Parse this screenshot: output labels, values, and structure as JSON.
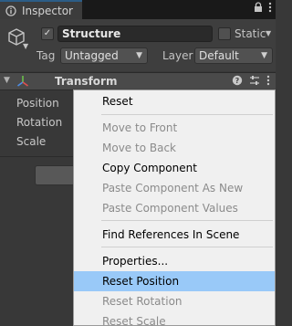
{
  "tab": {
    "title": "Inspector",
    "icon": "info-icon"
  },
  "tab_actions": {
    "lock": "lock-icon",
    "menu": "kebab-icon"
  },
  "object": {
    "active": true,
    "name": "Structure",
    "static_label": "Static",
    "tag_label": "Tag",
    "tag_value": "Untagged",
    "layer_label": "Layer",
    "layer_value": "Default"
  },
  "component": {
    "title": "Transform",
    "properties": [
      "Position",
      "Rotation",
      "Scale"
    ],
    "actions": [
      "help-icon",
      "settings-icon",
      "kebab-icon"
    ]
  },
  "context_menu": {
    "items": [
      {
        "label": "Reset",
        "enabled": true
      },
      {
        "label": "Move to Front",
        "enabled": false
      },
      {
        "label": "Move to Back",
        "enabled": false
      },
      {
        "label": "Copy Component",
        "enabled": true
      },
      {
        "label": "Paste Component As New",
        "enabled": false
      },
      {
        "label": "Paste Component Values",
        "enabled": false
      },
      {
        "label": "Find References In Scene",
        "enabled": true
      },
      {
        "label": "Properties...",
        "enabled": true
      },
      {
        "label": "Reset Position",
        "enabled": true,
        "highlighted": true
      },
      {
        "label": "Reset Rotation",
        "enabled": false
      },
      {
        "label": "Reset Scale",
        "enabled": false
      }
    ]
  },
  "colors": {
    "highlight": "#99c9f8",
    "accent": "#2c5d87",
    "panel": "#383838",
    "menu_bg": "#f0f0f0"
  }
}
